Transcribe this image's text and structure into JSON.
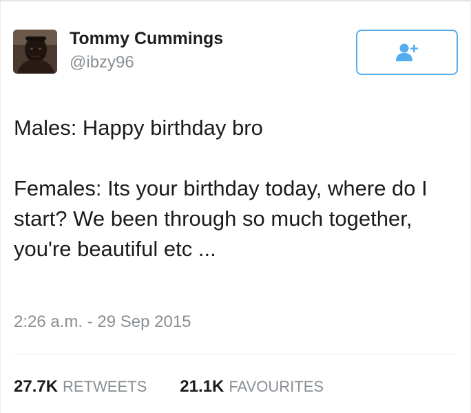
{
  "tweet": {
    "author": {
      "display_name": "Tommy Cummings",
      "handle": "@ibzy96",
      "avatar_icon": "user-avatar-photo"
    },
    "follow_button": {
      "icon": "follow-user-plus-icon",
      "accent_color": "#55acee"
    },
    "text": {
      "line_1": "Males: Happy birthday bro",
      "line_2": "Females: Its your birthday today, where do I start? We been through so much together, you're beautiful etc ..."
    },
    "timestamp": "2:26 a.m. - 29 Sep 2015",
    "stats": {
      "retweets": {
        "count": "27.7K",
        "label": "RETWEETS"
      },
      "favourites": {
        "count": "21.1K",
        "label": "FAVOURITES"
      }
    }
  },
  "colors": {
    "name_text": "#1e1e1e",
    "secondary_text": "#8a8f94",
    "accent": "#55acee",
    "divider": "#e1e8ed"
  }
}
